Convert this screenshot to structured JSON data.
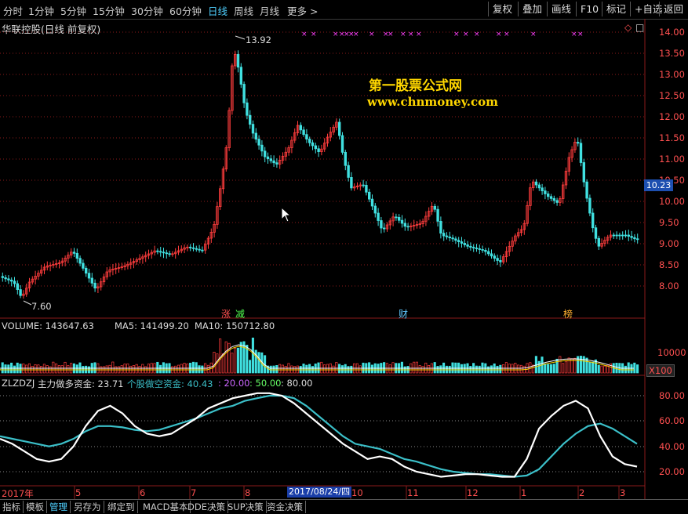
{
  "topbar": {
    "periods": [
      "分时",
      "1分钟",
      "5分钟",
      "15分钟",
      "30分钟",
      "60分钟",
      "日线",
      "周线",
      "月线",
      "更多 >"
    ],
    "active_period": "日线",
    "buttons": [
      "复权",
      "叠加",
      "画线",
      "F10",
      "标记",
      "+自选",
      "返回"
    ]
  },
  "stock": {
    "title": "华联控股(日线 前复权)"
  },
  "price_chart": {
    "ylabels": [
      "14.00",
      "13.50",
      "13.00",
      "12.50",
      "12.00",
      "11.50",
      "11.00",
      "10.50",
      "10.00",
      "9.50",
      "9.00",
      "8.50",
      "8.00"
    ],
    "high_label": "13.92",
    "low_label": "7.60",
    "current_price": "10.23",
    "event_marks": [
      {
        "text": "涨",
        "color": "#ff5050"
      },
      {
        "text": "减",
        "color": "#50ff50"
      },
      {
        "text": "财",
        "color": "#60c8ff"
      },
      {
        "text": "榜",
        "color": "#ffb030"
      }
    ]
  },
  "watermark": {
    "line1": "第一股票公式网",
    "line2": "www.chnmoney.com"
  },
  "volume": {
    "label": "VOLUME: 143647.63",
    "ma5": "MA5: 141499.20",
    "ma10": "MA10: 150712.80",
    "ylabel": "10000",
    "unit": "X100"
  },
  "indicator": {
    "name": "ZLZDZJ",
    "main_label": "主力做多资金: 23.71",
    "sub_label": "个股做空资金: 40.43",
    "lvl20": ": 20.00",
    "lvl50": ": 50.00",
    "lvl80": ": 80.00",
    "ylabels": [
      "80.00",
      "60.00",
      "40.00",
      "20.00"
    ],
    "white_line": [
      46,
      42,
      36,
      30,
      28,
      30,
      40,
      56,
      68,
      72,
      66,
      56,
      50,
      48,
      50,
      56,
      62,
      70,
      74,
      78,
      80,
      82,
      82,
      80,
      74,
      66,
      58,
      50,
      42,
      36,
      30,
      32,
      30,
      24,
      20,
      18,
      16,
      17,
      18,
      18,
      17,
      16,
      16,
      30,
      54,
      64,
      72,
      76,
      70,
      48,
      32,
      26,
      24
    ],
    "cyan_line": [
      48,
      46,
      44,
      42,
      40,
      42,
      46,
      52,
      56,
      56,
      55,
      53,
      52,
      53,
      56,
      59,
      62,
      66,
      70,
      72,
      76,
      78,
      80,
      80,
      78,
      72,
      64,
      56,
      48,
      42,
      40,
      38,
      34,
      30,
      28,
      25,
      22,
      20,
      19,
      18,
      18,
      17,
      16,
      17,
      22,
      32,
      42,
      50,
      56,
      58,
      54,
      48,
      42
    ]
  },
  "xaxis": {
    "labels": [
      "2017年",
      "5",
      "6",
      "7",
      "8",
      "10",
      "11",
      "12",
      "1",
      "2",
      "3"
    ],
    "date_box": "2017/08/24/四"
  },
  "bottom_tabs": [
    "指标",
    "模板",
    "管理",
    "另存为",
    "绑定到",
    "MACD基本",
    "DDE决策",
    "SUP决策",
    "资金决策"
  ],
  "active_tab": "管理",
  "colors": {
    "up": "#ff3c3c",
    "down": "#40e0e0",
    "grid": "#8a1a1a",
    "white_line": "#ffffff",
    "cyan_line": "#3bbfc8",
    "magenta_mark": "#ff40ff"
  }
}
